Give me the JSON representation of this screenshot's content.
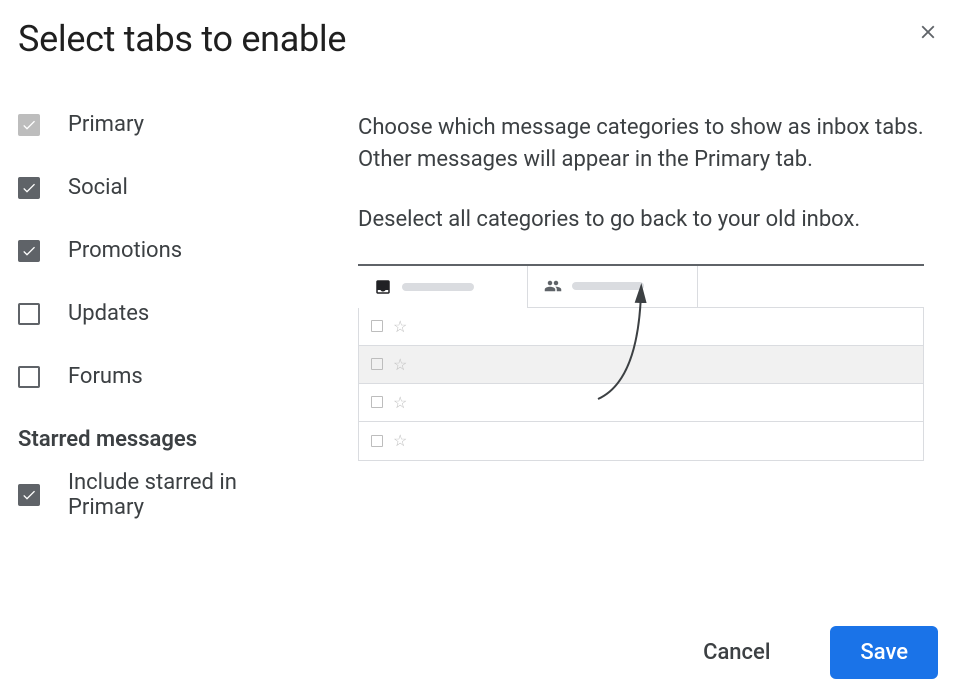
{
  "dialog": {
    "title": "Select tabs to enable"
  },
  "categories": [
    {
      "label": "Primary",
      "checked": true,
      "disabled": true
    },
    {
      "label": "Social",
      "checked": true,
      "disabled": false
    },
    {
      "label": "Promotions",
      "checked": true,
      "disabled": false
    },
    {
      "label": "Updates",
      "checked": false,
      "disabled": false
    },
    {
      "label": "Forums",
      "checked": false,
      "disabled": false
    }
  ],
  "starred_section": {
    "heading": "Starred messages",
    "option": {
      "label": "Include starred in Primary",
      "checked": true
    }
  },
  "description": {
    "paragraph1": "Choose which message categories to show as inbox tabs. Other messages will appear in the Primary tab.",
    "paragraph2": "Deselect all categories to go back to your old inbox."
  },
  "buttons": {
    "cancel": "Cancel",
    "save": "Save"
  }
}
